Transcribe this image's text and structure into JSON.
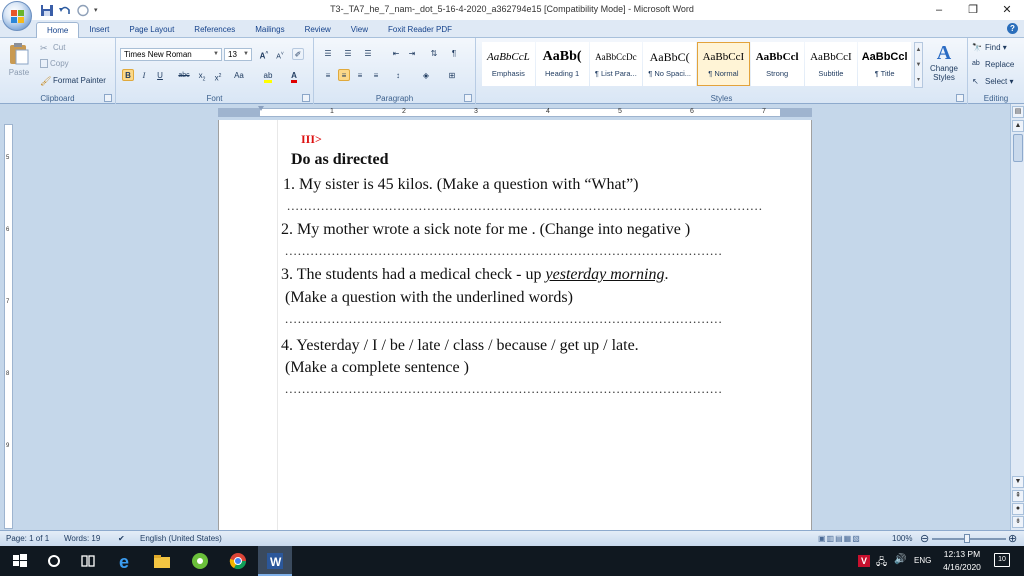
{
  "window": {
    "title": "T3-_TA7_he_7_nam-_dot_5-16-4-2020_a362794e15 [Compatibility Mode] - Microsoft Word",
    "controls": [
      "–",
      "❐",
      "✕"
    ]
  },
  "tabs": [
    "Home",
    "Insert",
    "Page Layout",
    "References",
    "Mailings",
    "Review",
    "View",
    "Foxit Reader PDF"
  ],
  "active_tab": "Home",
  "clipboard": {
    "label": "Clipboard",
    "paste": "Paste",
    "cut": "Cut",
    "copy": "Copy",
    "format_painter": "Format Painter"
  },
  "font": {
    "label": "Font",
    "family": "Times New Roman",
    "size": "13"
  },
  "paragraph": {
    "label": "Paragraph"
  },
  "styles": {
    "label": "Styles",
    "items": [
      {
        "sample": "AaBbCcL",
        "name": "Emphasis"
      },
      {
        "sample": "AaBb(",
        "name": "Heading 1"
      },
      {
        "sample": "AaBbCcDc",
        "name": "¶ List Para..."
      },
      {
        "sample": "AaBbC(",
        "name": "¶ No Spaci..."
      },
      {
        "sample": "AaBbCcI",
        "name": "¶ Normal"
      },
      {
        "sample": "AaBbCcl",
        "name": "Strong"
      },
      {
        "sample": "AaBbCcI",
        "name": "Subtitle"
      },
      {
        "sample": "AaBbCcl",
        "name": "¶ Title"
      }
    ],
    "selected_index": 4,
    "change_styles": "Change Styles"
  },
  "editing": {
    "label": "Editing",
    "find": "Find",
    "replace": "Replace",
    "select": "Select"
  },
  "document": {
    "section": "III>",
    "heading": "Do as directed",
    "q1": "1. My sister is 45 kilos. (Make a question with “What”)",
    "q2": "2. My mother wrote a sick note for me . (Change into negative )",
    "q3_a": "3. The students had a medical check - up",
    "q3_underlined": "yesterday morning",
    "q3_b": "(Make a question with the underlined words)",
    "q4_a": "4. Yesterday / I / be / late / class / because / get up / late.",
    "q4_b": "(Make a complete sentence )"
  },
  "status": {
    "page": "Page: 1 of 1",
    "words": "Words: 19",
    "language": "English (United States)",
    "zoom": "100%"
  },
  "taskbar": {
    "lang": "ENG",
    "time": "12:13 PM",
    "date": "4/16/2020"
  }
}
